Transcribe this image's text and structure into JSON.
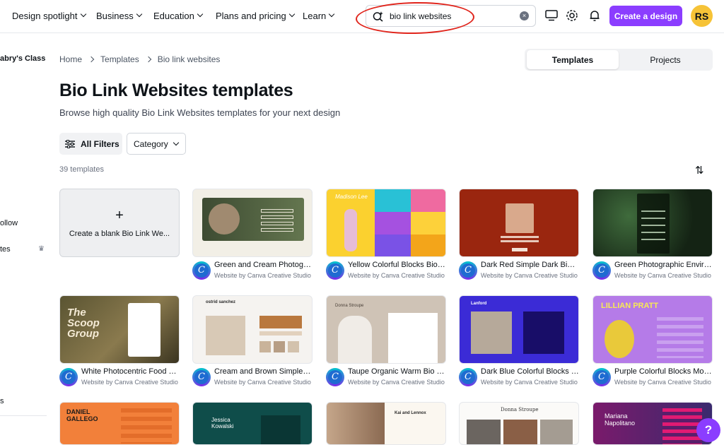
{
  "nav": {
    "items": [
      "Design spotlight",
      "Business",
      "Education",
      "Plans and pricing",
      "Learn"
    ]
  },
  "search": {
    "value": "bio link websites",
    "clear_glyph": "×"
  },
  "header": {
    "create_label": "Create a design",
    "avatar_initials": "RS"
  },
  "sidebar": {
    "class_label": "abry's Class",
    "follow_label": "ollow",
    "item_label": "tes",
    "bottom_label": "s"
  },
  "breadcrumb": {
    "home": "Home",
    "templates": "Templates",
    "current": "Bio link websites"
  },
  "tabs": {
    "templates": "Templates",
    "projects": "Projects"
  },
  "page": {
    "title": "Bio Link Websites templates",
    "subtitle": "Browse high quality Bio Link Websites templates for your next design",
    "all_filters": "All Filters",
    "category": "Category",
    "count": "39 templates",
    "blank_label": "Create a blank Bio Link We..."
  },
  "cards": [
    {
      "title": "Green and Cream Photographic",
      "by": "Website by Canva Creative Studio"
    },
    {
      "title": "Yellow Colorful Blocks Bio Link",
      "by": "Website by Canva Creative Studio"
    },
    {
      "title": "Dark Red Simple Dark Bio Link",
      "by": "Website by Canva Creative Studio"
    },
    {
      "title": "Green Photographic Environment",
      "by": "Website by Canva Creative Studio"
    },
    {
      "title": "White Photocentric Food Website",
      "by": "Website by Canva Creative Studio"
    },
    {
      "title": "Cream and Brown Simple Website",
      "by": "Website by Canva Creative Studio"
    },
    {
      "title": "Taupe Organic Warm Bio Link",
      "by": "Website by Canva Creative Studio"
    },
    {
      "title": "Dark Blue Colorful Blocks Website",
      "by": "Website by Canva Creative Studio"
    },
    {
      "title": "Purple Colorful Blocks Modern",
      "by": "Website by Canva Creative Studio"
    }
  ],
  "thumb_text": {
    "yellow_name": "Madison Lee",
    "scoop": "The Scoop Group",
    "ostrid": "ostrid sanchez",
    "donna": "Donna Stroupe",
    "lanford": "Lanford",
    "lillian": "LILLIAN PRATT",
    "daniel": "DANIEL GALLEGO",
    "jessica": "Jessica Kowalski",
    "kai": "Kai and Lennox",
    "mariana": "Mariana Napolitano"
  },
  "help_label": "?",
  "colors": {
    "accent": "#8b3dff",
    "avatar": "#f6c337",
    "annotation": "#e0241b"
  }
}
